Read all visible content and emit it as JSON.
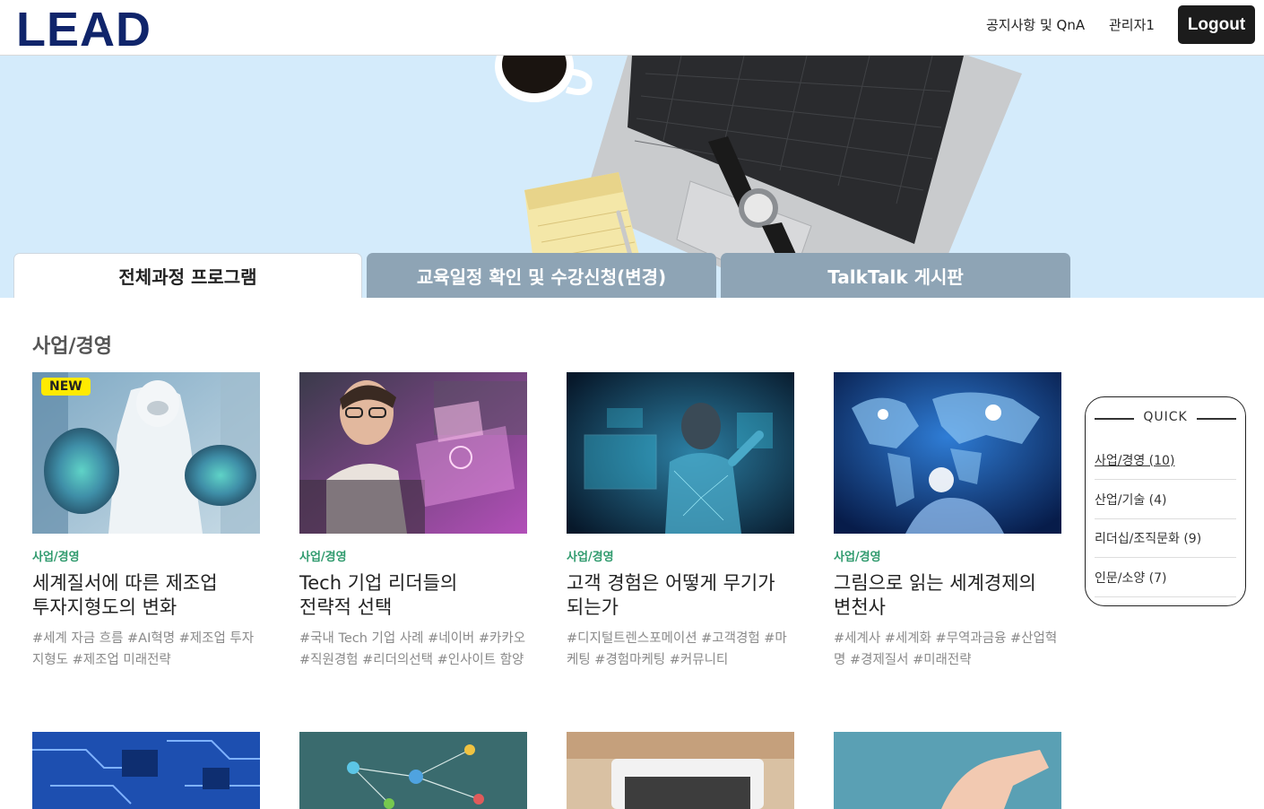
{
  "header": {
    "logo": "LEAD",
    "notice_link": "공지사항 및 QnA",
    "admin_link": "관리자1",
    "logout_label": "Logout"
  },
  "tabs": [
    {
      "label": "전체과정 프로그램",
      "active": true
    },
    {
      "label": "교육일정 확인 및 수강신청(변경)",
      "active": false
    },
    {
      "label": "TalkTalk 게시판",
      "active": false
    }
  ],
  "section": {
    "title": "사업/경영"
  },
  "cards": [
    {
      "badge": "NEW",
      "category": "사업/경영",
      "title_line1": "세계질서에 따른 제조업",
      "title_line2": "투자지형도의 변화",
      "tags": "#세계 자금 흐름 #AI혁명 #제조업 투자지형도 #제조업 미래전략"
    },
    {
      "category": "사업/경영",
      "title_line1": "Tech 기업 리더들의",
      "title_line2": "전략적 선택",
      "tags": "#국내 Tech 기업 사례 #네이버 #카카오 #직원경험 #리더의선택 #인사이트 함양"
    },
    {
      "category": "사업/경영",
      "title_line1": "고객 경험은 어떻게 무기가",
      "title_line2": "되는가",
      "tags": "#디지털트렌스포메이션 #고객경험 #마케팅 #경험마케팅 #커뮤니티"
    },
    {
      "category": "사업/경영",
      "title_line1": "그림으로 읽는 세계경제의",
      "title_line2": "변천사",
      "tags": "#세계사 #세계화 #무역과금융 #산업혁명 #경제질서 #미래전략"
    }
  ],
  "quick": {
    "title": "QUICK",
    "items": [
      "사업/경영 (10)",
      "산업/기술 (4)",
      "리더십/조직문화 (9)",
      "인문/소양 (7)"
    ]
  },
  "colors": {
    "brand": "#10256b",
    "banner_bg": "#d4ebfb",
    "tab_inactive": "#8ea4b5",
    "category": "#2f9a6d",
    "badge": "#ffea00"
  }
}
